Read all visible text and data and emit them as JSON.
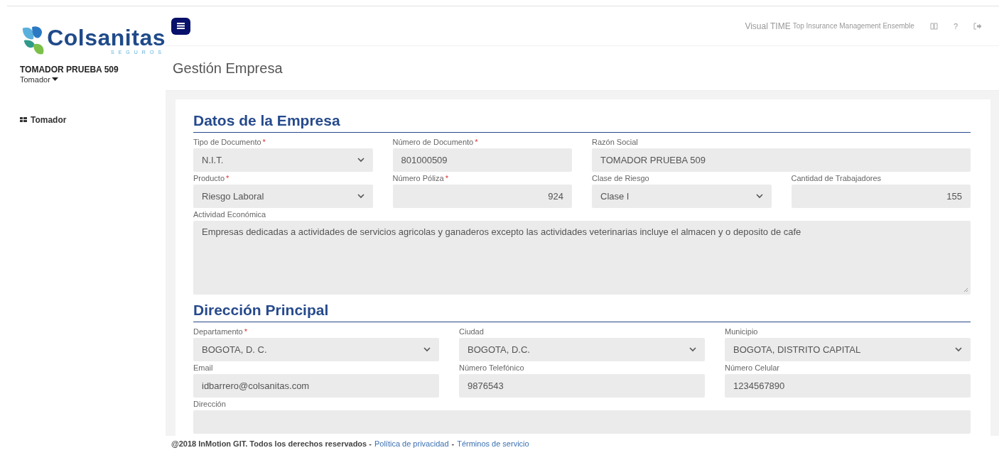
{
  "sidebar": {
    "brand": "Colsanitas",
    "brand_sub": "SEGUROS",
    "user_name": "TOMADOR PRUEBA 509",
    "role": "Tomador",
    "items": [
      {
        "label": "Tomador",
        "selected": false
      }
    ]
  },
  "topbar": {
    "app_name": "Visual TIME",
    "app_tagline": "Top Insurance Management Ensemble",
    "help": "?"
  },
  "page_title": "Gestión Empresa",
  "sections": [
    {
      "title": "Datos de la Empresa",
      "kind": "company",
      "fields": [
        {
          "label": "Tipo de Documento",
          "mark": "*",
          "kind": "select",
          "value": "N.I.T."
        },
        {
          "label": "Número de Documento",
          "mark": "*",
          "kind": "text",
          "value": "801000509"
        },
        {
          "label": "Razón Social",
          "kind": "text",
          "value": "TOMADOR PRUEBA 509"
        },
        {
          "label": "Producto",
          "mark": "*",
          "kind": "select",
          "value": "Riesgo Laboral"
        },
        {
          "label": "Número Póliza",
          "mark": "*",
          "kind": "number",
          "value": "924"
        },
        {
          "label": "Clase de Riesgo",
          "kind": "select",
          "value": "Clase I"
        },
        {
          "label": "Cantidad de Trabajadores",
          "kind": "number",
          "value": "155"
        },
        {
          "label": "Actividad Económica",
          "kind": "textarea",
          "value": "Empresas dedicadas a actividades de servicios agricolas y ganaderos excepto las actividades veterinarias incluye el almacen y o deposito de cafe"
        }
      ]
    },
    {
      "title": "Dirección Principal",
      "kind": "address",
      "fields": [
        {
          "label": "Departamento",
          "mark": "*",
          "kind": "select",
          "value": "BOGOTA, D. C."
        },
        {
          "label": "Ciudad",
          "kind": "select",
          "value": "BOGOTA, D.C."
        },
        {
          "label": "Municipio",
          "kind": "select",
          "value": "BOGOTA, DISTRITO CAPITAL"
        },
        {
          "label": "Email",
          "kind": "text",
          "value": "idbarrero@colsanitas.com"
        },
        {
          "label": "Número Telefónico",
          "kind": "text",
          "value": "9876543"
        },
        {
          "label": "Número Celular",
          "kind": "text",
          "value": "1234567890"
        },
        {
          "label": "Dirección",
          "kind": "text"
        }
      ]
    }
  ],
  "footer": [
    {
      "kind": "text",
      "text": "@2018 InMotion GIT. Todos los derechos reservados -"
    },
    {
      "kind": "link",
      "text": "Política de privacidad"
    },
    {
      "kind": "text",
      "text": "-"
    },
    {
      "kind": "link",
      "text": "Términos de servicio"
    }
  ]
}
